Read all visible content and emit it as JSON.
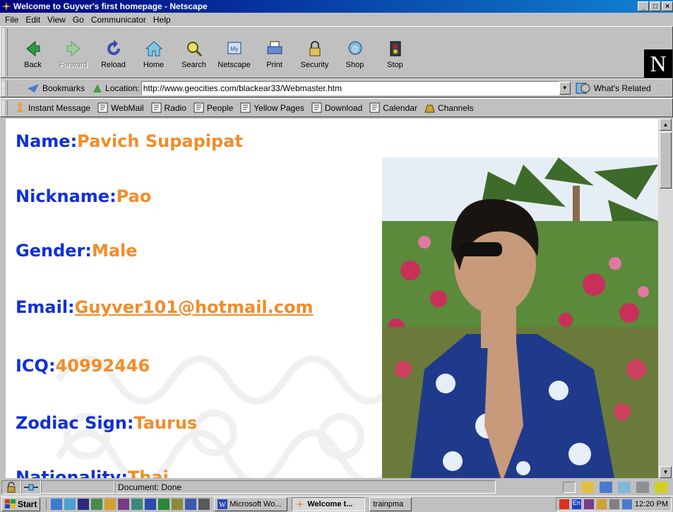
{
  "window": {
    "title": "Welcome to Guyver's first homepage - Netscape",
    "controls": [
      "_",
      "□",
      "×"
    ]
  },
  "menubar": {
    "items": [
      "File",
      "Edit",
      "View",
      "Go",
      "Communicator",
      "Help"
    ]
  },
  "nav_toolbar": {
    "buttons": [
      {
        "label": "Back",
        "icon": "back-arrow-icon",
        "enabled": true
      },
      {
        "label": "Forward",
        "icon": "forward-arrow-icon",
        "enabled": false
      },
      {
        "label": "Reload",
        "icon": "reload-icon",
        "enabled": true
      },
      {
        "label": "Home",
        "icon": "home-icon",
        "enabled": true
      },
      {
        "label": "Search",
        "icon": "search-icon",
        "enabled": true
      },
      {
        "label": "Netscape",
        "icon": "netscape-icon",
        "enabled": true
      },
      {
        "label": "Print",
        "icon": "print-icon",
        "enabled": true
      },
      {
        "label": "Security",
        "icon": "lock-icon",
        "enabled": true
      },
      {
        "label": "Shop",
        "icon": "shop-icon",
        "enabled": true
      },
      {
        "label": "Stop",
        "icon": "stop-icon",
        "enabled": true
      }
    ],
    "logo_letter": "N"
  },
  "location_bar": {
    "bookmarks_label": "Bookmarks",
    "location_label": "Location:",
    "url": "http://www.geocities.com/blackear33/Webmaster.htm",
    "related_label": "What's Related"
  },
  "personal_toolbar": {
    "items": [
      "Instant Message",
      "WebMail",
      "Radio",
      "People",
      "Yellow Pages",
      "Download",
      "Calendar",
      "Channels"
    ]
  },
  "page": {
    "fields": [
      {
        "key": "Name:",
        "value": "Pavich Supapipat"
      },
      {
        "key": "Nickname:",
        "value": "Pao"
      },
      {
        "key": "Gender:",
        "value": "Male"
      },
      {
        "key": "Email:",
        "value": "Guyver101@hotmail.com"
      },
      {
        "key": "ICQ:",
        "value": "40992446"
      },
      {
        "key": "Zodiac Sign:",
        "value": "Taurus"
      },
      {
        "key": "Nationality:",
        "value": "Thai"
      }
    ],
    "colors": {
      "key": "#1030d8",
      "value": "#f28c28"
    }
  },
  "statusbar": {
    "text": "Document: Done"
  },
  "taskbar": {
    "start_label": "Start",
    "tasks": [
      "Microsoft Wo...",
      "Welcome t...",
      "trainpma"
    ],
    "clock": "12:20 PM",
    "tray_lang": "En"
  }
}
